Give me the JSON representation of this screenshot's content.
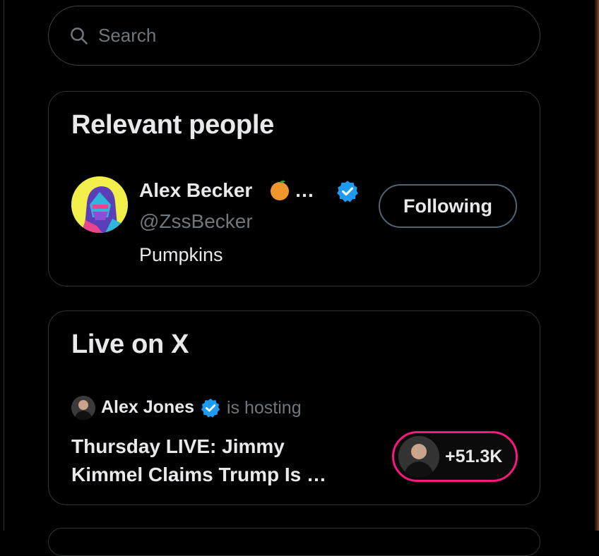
{
  "search": {
    "placeholder": "Search",
    "icon": "search-icon"
  },
  "relevant_people": {
    "title": "Relevant people",
    "person": {
      "name": "Alex Becker",
      "name_suffix": "…",
      "emoji_icon": "orange-fruit-icon",
      "verified": true,
      "handle": "@ZssBecker",
      "bio": "Pumpkins",
      "follow_button_label": "Following"
    }
  },
  "live_on_x": {
    "title": "Live on X",
    "host": {
      "name": "Alex Jones",
      "verified": true,
      "status": "is hosting"
    },
    "space_title": "Thursday LIVE: Jimmy Kimmel Claims Trump Is …",
    "listener_count": "+51.3K"
  },
  "colors": {
    "background": "#000000",
    "border": "#2f3336",
    "text_primary": "#e7e9ea",
    "text_secondary": "#71767b",
    "verified_blue": "#1d9bf0",
    "live_pink": "#f91880"
  }
}
